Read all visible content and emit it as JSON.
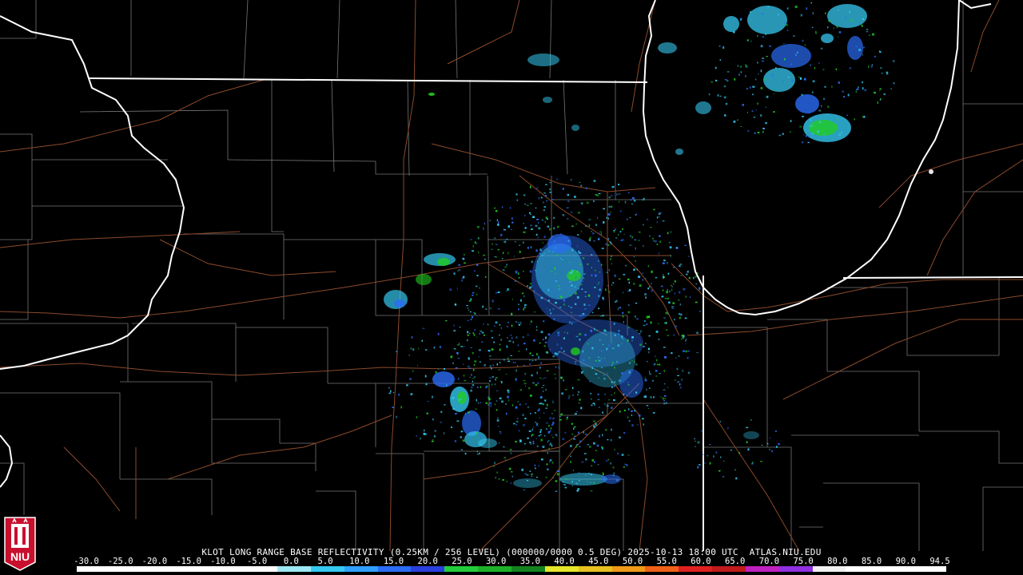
{
  "product_title": "KLOT LONG RANGE BASE REFLECTIVITY (0.25KM / 256 LEVEL) (000000/0000 0.5 DEG) 2025-10-13 18:00 UTC  ATLAS.NIU.EDU",
  "logo_text": "NIU",
  "colors": {
    "background": "#000000",
    "state_lines": "#ffffff",
    "county_lines": "#8a8a8a",
    "roads": "#8b4a2b",
    "echo_light_blue": "#35c8f0",
    "echo_blue": "#2a6cf5",
    "echo_green": "#22cc22",
    "logo_red": "#c8102e"
  },
  "scale": {
    "labels": [
      "-30.0",
      "-25.0",
      "-20.0",
      "-15.0",
      "-10.0",
      "-5.0",
      "0.0",
      "5.0",
      "10.0",
      "15.0",
      "20.0",
      "25.0",
      "30.0",
      "35.0",
      "40.0",
      "45.0",
      "50.0",
      "55.0",
      "60.0",
      "65.0",
      "70.0",
      "75.0",
      "80.0",
      "85.0",
      "90.0",
      "94.5"
    ],
    "colors": [
      "#ffffff",
      "#ffffff",
      "#ffffff",
      "#ffffff",
      "#ffffff",
      "#ffffff",
      "#9fe8f5",
      "#35c8f0",
      "#2fa0ff",
      "#2a6cf5",
      "#2a3fe0",
      "#23cc3a",
      "#1fb02a",
      "#14821e",
      "#e6e62a",
      "#e8c020",
      "#f09a18",
      "#f06018",
      "#e02020",
      "#c01a1a",
      "#c020c0",
      "#9030e0",
      "#f0f0f0",
      "#ffffff",
      "#ffffff",
      "#ffffff"
    ]
  }
}
